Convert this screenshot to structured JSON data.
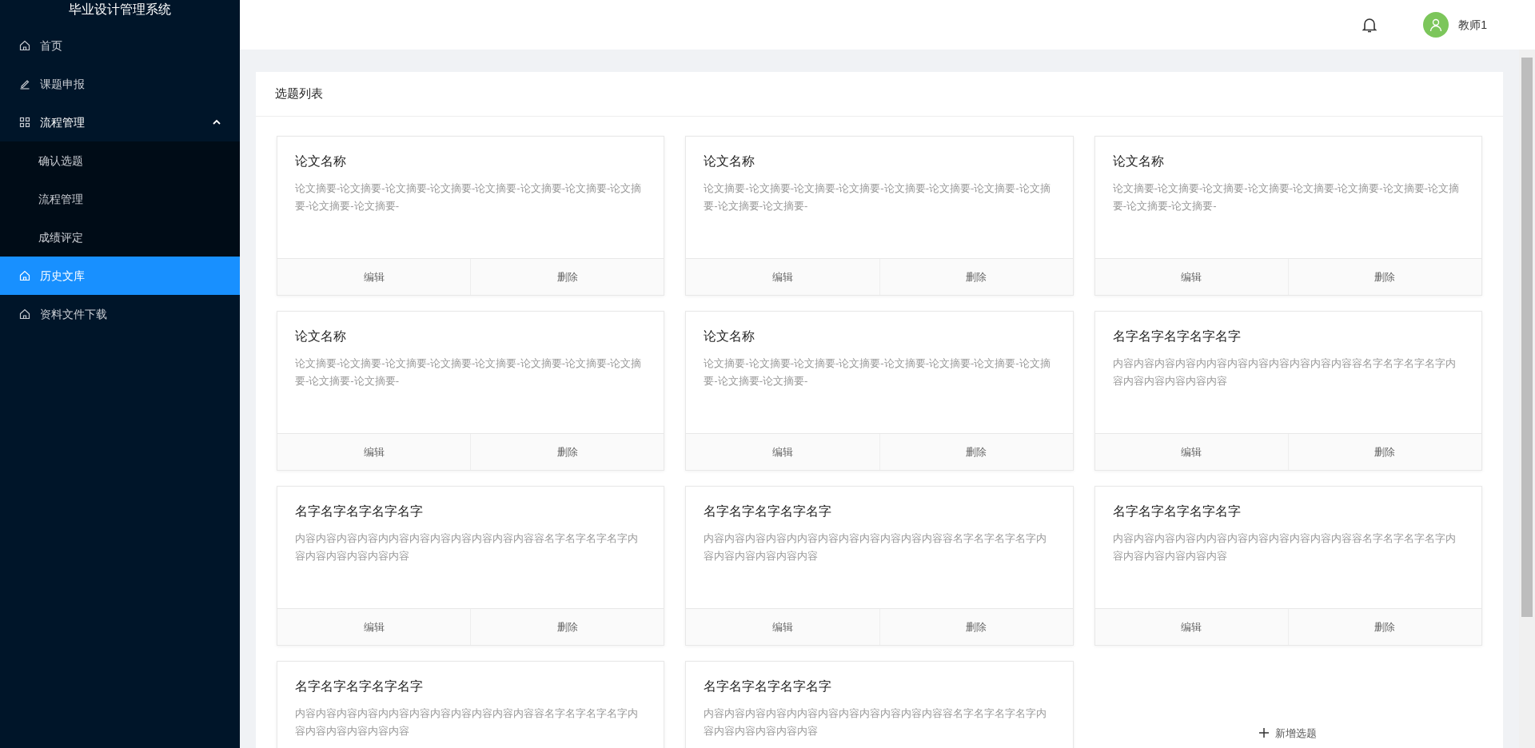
{
  "app_title": "毕业设计管理系统",
  "menu": [
    {
      "label": "首页",
      "selected": false
    },
    {
      "label": "课题申报",
      "selected": false
    },
    {
      "label": "流程管理",
      "selected": false,
      "expanded": true,
      "children": [
        {
          "label": "确认选题",
          "selected": false
        },
        {
          "label": "流程管理",
          "selected": false
        },
        {
          "label": "成绩评定",
          "selected": false
        }
      ]
    },
    {
      "label": "历史文库",
      "selected": true
    },
    {
      "label": "资料文件下载",
      "selected": false
    }
  ],
  "header": {
    "user_name": "教师1"
  },
  "panel": {
    "title": "选题列表",
    "cards": [
      {
        "title": "论文名称",
        "summary": "论文摘要-论文摘要-论文摘要-论文摘要-论文摘要-论文摘要-论文摘要-论文摘要-论文摘要-论文摘要-",
        "actions": [
          "编辑",
          "删除"
        ]
      },
      {
        "title": "论文名称",
        "summary": "论文摘要-论文摘要-论文摘要-论文摘要-论文摘要-论文摘要-论文摘要-论文摘要-论文摘要-论文摘要-",
        "actions": [
          "编辑",
          "删除"
        ]
      },
      {
        "title": "论文名称",
        "summary": "论文摘要-论文摘要-论文摘要-论文摘要-论文摘要-论文摘要-论文摘要-论文摘要-论文摘要-论文摘要-",
        "actions": [
          "编辑",
          "删除"
        ]
      },
      {
        "title": "论文名称",
        "summary": "论文摘要-论文摘要-论文摘要-论文摘要-论文摘要-论文摘要-论文摘要-论文摘要-论文摘要-论文摘要-",
        "actions": [
          "编辑",
          "删除"
        ]
      },
      {
        "title": "论文名称",
        "summary": "论文摘要-论文摘要-论文摘要-论文摘要-论文摘要-论文摘要-论文摘要-论文摘要-论文摘要-论文摘要-",
        "actions": [
          "编辑",
          "删除"
        ]
      },
      {
        "title": "名字名字名字名字名字",
        "summary": "内容内容内容内容内内容内容内容内容内容内容内容容名字名字名字名字内容内容内容内容内容内容",
        "actions": [
          "编辑",
          "删除"
        ]
      },
      {
        "title": "名字名字名字名字名字",
        "summary": "内容内容内容内容内内容内容内容内容内容内容内容容名字名字名字名字内容内容内容内容内容内容",
        "actions": [
          "编辑",
          "删除"
        ]
      },
      {
        "title": "名字名字名字名字名字",
        "summary": "内容内容内容内容内内容内容内容内容内容内容内容容名字名字名字名字内容内容内容内容内容内容",
        "actions": [
          "编辑",
          "删除"
        ]
      },
      {
        "title": "名字名字名字名字名字",
        "summary": "内容内容内容内容内内容内容内容内容内容内容内容容名字名字名字名字内容内容内容内容内容内容",
        "actions": [
          "编辑",
          "删除"
        ]
      },
      {
        "title": "名字名字名字名字名字",
        "summary": "内容内容内容内容内内容内容内容内容内容内容内容容名字名字名字名字内容内容内容内容内容内容"
      },
      {
        "title": "名字名字名字名字名字",
        "summary": "内容内容内容内容内内容内容内容内容内容内容内容容名字名字名字名字内容内容内容内容内容内容"
      }
    ],
    "add_card": {
      "label": "新增选题"
    }
  }
}
